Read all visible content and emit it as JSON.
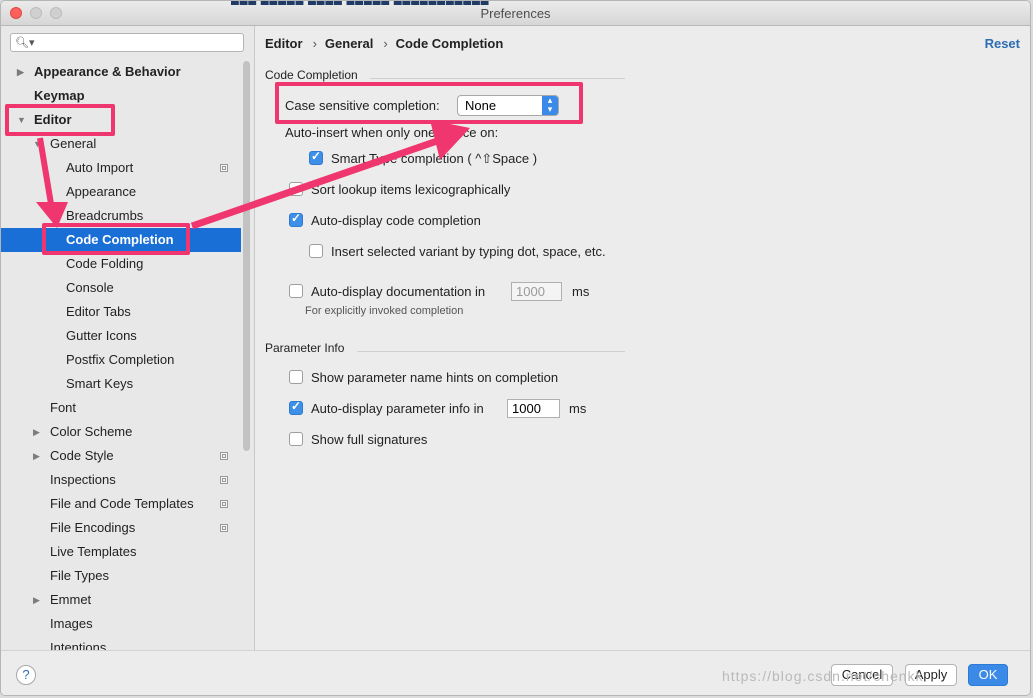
{
  "window": {
    "title": "Preferences",
    "bg_strip": "▇▇▇ ▇▇▇▇▇ ▇▇▇▇ ▇▇▇▇▇ ▇▇▇▇▇▇▇▇▇▇▇"
  },
  "colors": {
    "selection": "#1a6fd6",
    "accent": "#3b8ae8",
    "highlight": "#f0366e",
    "link": "#2f6db3"
  },
  "sidebar": {
    "search": {
      "placeholder": "",
      "icon": "search-icon"
    },
    "items": [
      {
        "label": "Appearance & Behavior",
        "expander": "▶",
        "bold": true
      },
      {
        "label": "Keymap",
        "bold": true
      },
      {
        "label": "Editor",
        "expander": "▼",
        "bold": true
      },
      {
        "label": "General",
        "expander": "▼"
      },
      {
        "label": "Auto Import",
        "copy_icon": true
      },
      {
        "label": "Appearance"
      },
      {
        "label": "Breadcrumbs"
      },
      {
        "label": "Code Completion",
        "selected": true
      },
      {
        "label": "Code Folding"
      },
      {
        "label": "Console"
      },
      {
        "label": "Editor Tabs"
      },
      {
        "label": "Gutter Icons"
      },
      {
        "label": "Postfix Completion"
      },
      {
        "label": "Smart Keys"
      },
      {
        "label": "Font"
      },
      {
        "label": "Color Scheme",
        "expander": "▶"
      },
      {
        "label": "Code Style",
        "expander": "▶",
        "copy_icon": true
      },
      {
        "label": "Inspections",
        "copy_icon": true
      },
      {
        "label": "File and Code Templates",
        "copy_icon": true
      },
      {
        "label": "File Encodings",
        "copy_icon": true
      },
      {
        "label": "Live Templates"
      },
      {
        "label": "File Types"
      },
      {
        "label": "Emmet",
        "expander": "▶"
      },
      {
        "label": "Images"
      },
      {
        "label": "Intentions"
      }
    ]
  },
  "main": {
    "breadcrumb": [
      "Editor",
      "General",
      "Code Completion"
    ],
    "reset_label": "Reset",
    "code_completion": {
      "section": "Code Completion",
      "case_sensitive_label": "Case sensitive completion:",
      "case_sensitive_value": "None",
      "auto_insert_label": "Auto-insert when only one choice on:",
      "smart_type_label": "Smart Type completion ( ^⇧Space )",
      "smart_type_checked": true,
      "sort_lexi_label": "Sort lookup items lexicographically",
      "sort_lexi_checked": false,
      "auto_display_label": "Auto-display code completion",
      "auto_display_checked": true,
      "insert_variant_label": "Insert selected variant by typing dot, space, etc.",
      "insert_variant_checked": false,
      "auto_doc_label": "Auto-display documentation in",
      "auto_doc_checked": false,
      "auto_doc_value": "1000",
      "auto_doc_unit": "ms",
      "auto_doc_hint": "For explicitly invoked completion"
    },
    "parameter_info": {
      "section": "Parameter Info",
      "hints_label": "Show parameter name hints on completion",
      "hints_checked": false,
      "auto_param_label": "Auto-display parameter info in",
      "auto_param_checked": true,
      "auto_param_value": "1000",
      "auto_param_unit": "ms",
      "full_sig_label": "Show full signatures",
      "full_sig_checked": false
    }
  },
  "footer": {
    "help": "?",
    "cancel": "Cancel",
    "apply": "Apply",
    "ok": "OK",
    "watermark": "https://blog.csdn.net/chenkk"
  }
}
